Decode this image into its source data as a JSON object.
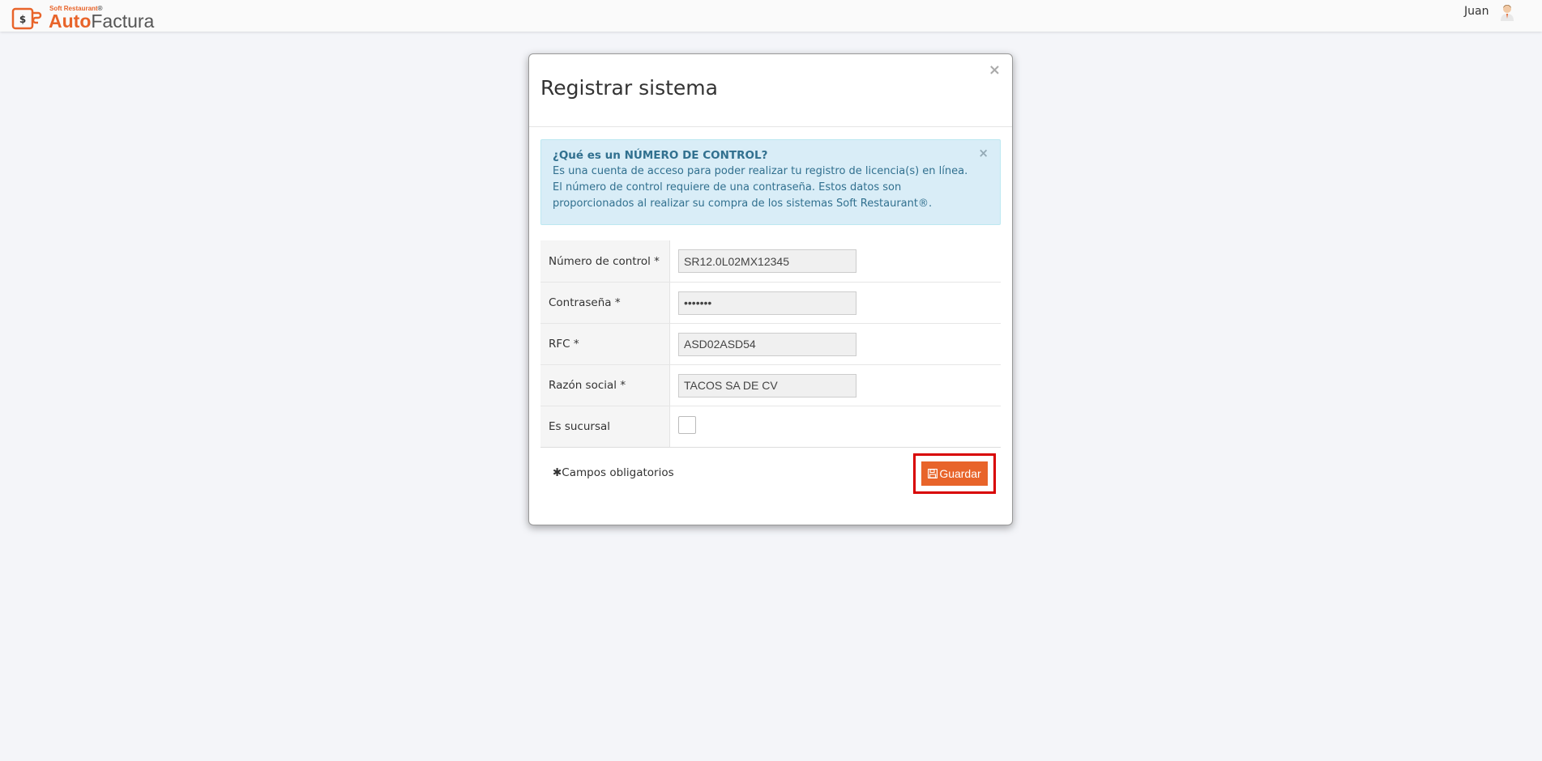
{
  "header": {
    "brand_small": "Soft Restaurant",
    "brand_reg": "®",
    "brand_auto": "Auto",
    "brand_factura": "Factura",
    "user_name": "Juan"
  },
  "modal": {
    "title": "Registrar sistema",
    "close_symbol": "×",
    "alert": {
      "title": "¿Qué es un NÚMERO DE CONTROL?",
      "body": "Es una cuenta de acceso para poder realizar tu registro de licencia(s) en línea. El número de control requiere de una contraseña. Estos datos son proporcionados al realizar su compra de los sistemas Soft Restaurant®.",
      "close_symbol": "×"
    },
    "form": {
      "control_number_label": "Número de control *",
      "control_number_value": "SR12.0L02MX12345",
      "password_label": "Contraseña *",
      "password_value": "1234567",
      "rfc_label": "RFC *",
      "rfc_value": "ASD02ASD54",
      "business_name_label": "Razón social *",
      "business_name_value": "TACOS SA DE CV",
      "branch_label": "Es sucursal",
      "branch_checked": false
    },
    "required_note": "✱Campos obligatorios",
    "save_label": "Guardar"
  },
  "colors": {
    "accent": "#e8642a",
    "alert_bg": "#d9edf7",
    "alert_text": "#31708f",
    "highlight": "#d80000"
  }
}
